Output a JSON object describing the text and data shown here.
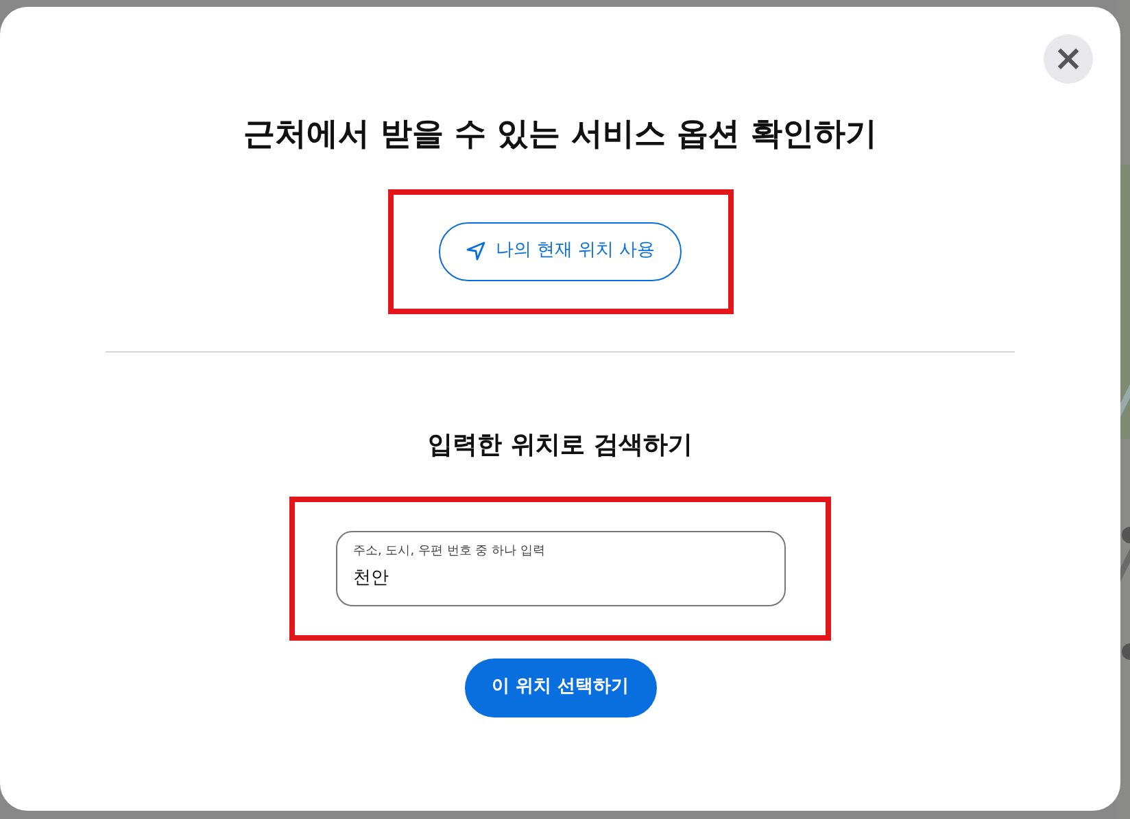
{
  "dialog": {
    "close_label": "×",
    "title": "근처에서 받을 수 있는 서비스 옵션 확인하기",
    "location_button": {
      "label": "나의 현재 위치 사용",
      "highlighted": true
    },
    "search_title": "입력한 위치로 검색하기",
    "search": {
      "placeholder": "주소, 도시, 우편 번호 중 하나 입력",
      "value": "천안",
      "highlighted": true
    },
    "submit_button": "이 위치 선택하기"
  }
}
